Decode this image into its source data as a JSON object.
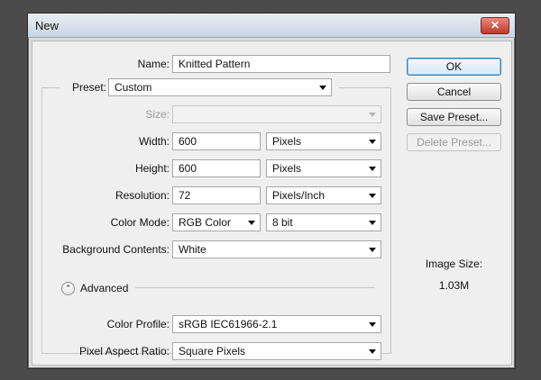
{
  "window": {
    "title": "New",
    "close_glyph": "✕"
  },
  "form": {
    "name_label": "Name:",
    "name_value": "Knitted Pattern",
    "preset_label": "Preset:",
    "preset_value": "Custom",
    "size_label": "Size:",
    "size_value": "",
    "width_label": "Width:",
    "width_value": "600",
    "width_unit": "Pixels",
    "height_label": "Height:",
    "height_value": "600",
    "height_unit": "Pixels",
    "resolution_label": "Resolution:",
    "resolution_value": "72",
    "resolution_unit": "Pixels/Inch",
    "color_mode_label": "Color Mode:",
    "color_mode_value": "RGB Color",
    "bit_depth_value": "8 bit",
    "background_label": "Background Contents:",
    "background_value": "White",
    "advanced_label": "Advanced",
    "advanced_toggle_glyph": "⌃",
    "color_profile_label": "Color Profile:",
    "color_profile_value": "sRGB IEC61966-2.1",
    "pixel_aspect_label": "Pixel Aspect Ratio:",
    "pixel_aspect_value": "Square Pixels"
  },
  "buttons": {
    "ok": "OK",
    "cancel": "Cancel",
    "save_preset": "Save Preset...",
    "delete_preset": "Delete Preset..."
  },
  "info": {
    "image_size_label": "Image Size:",
    "image_size_value": "1.03M"
  }
}
